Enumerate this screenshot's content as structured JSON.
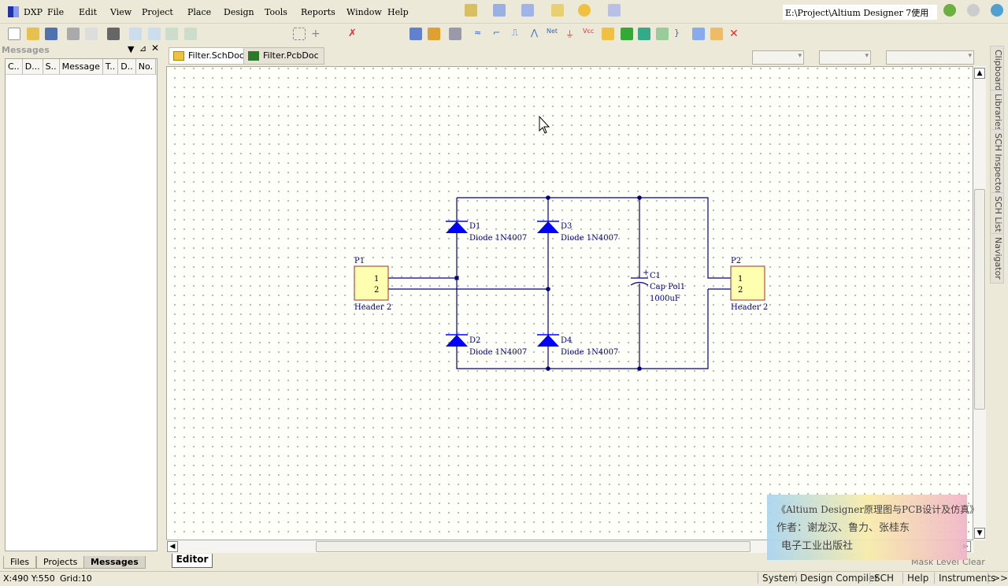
{
  "menubar": {
    "logo": "DXP",
    "items": [
      "File",
      "Edit",
      "View",
      "Project",
      "Place",
      "Design",
      "Tools",
      "Reports",
      "Window",
      "Help"
    ],
    "path": "E:\\Project\\Altium Designer 7使用"
  },
  "panel": {
    "title": "Messages",
    "columns": [
      "C..",
      "D...",
      "S..",
      "Message",
      "T..",
      "D..",
      "No."
    ],
    "tabs": [
      "Files",
      "Projects",
      "Messages"
    ]
  },
  "doc_tabs": [
    "Filter.SchDoc",
    "Filter.PcbDoc"
  ],
  "editor_tab": "Editor",
  "right_tabs": [
    "Clipboard",
    "Libraries",
    "SCH Inspector",
    "SCH List",
    "Navigator"
  ],
  "schematic": {
    "components": [
      {
        "ref": "P1",
        "value": "Header 2",
        "pins": [
          "1",
          "2"
        ]
      },
      {
        "ref": "P2",
        "value": "Header 2",
        "pins": [
          "1",
          "2"
        ]
      },
      {
        "ref": "D1",
        "value": "Diode 1N4007"
      },
      {
        "ref": "D2",
        "value": "Diode 1N4007"
      },
      {
        "ref": "D3",
        "value": "Diode 1N4007"
      },
      {
        "ref": "D4",
        "value": "Diode 1N4007"
      },
      {
        "ref": "C1",
        "value": "Cap Pol1",
        "value2": "1000uF",
        "polarity": "+"
      }
    ],
    "wire_color": "#00007f",
    "component_color": "#0000ff"
  },
  "bottom_right": {
    "mask_level": "Mask Level",
    "clear": "Clear"
  },
  "watermark": {
    "line1": "《Altium Designer原理图与PCB设计及仿真》",
    "line2": "作者：谢龙汉、鲁力、张桂东",
    "line3": "电子工业出版社"
  },
  "status": {
    "coords": "X:490 Y:550",
    "grid": "Grid:10",
    "items": [
      "System",
      "Design Compiler",
      "SCH",
      "Help",
      "Instruments",
      ">>"
    ]
  }
}
